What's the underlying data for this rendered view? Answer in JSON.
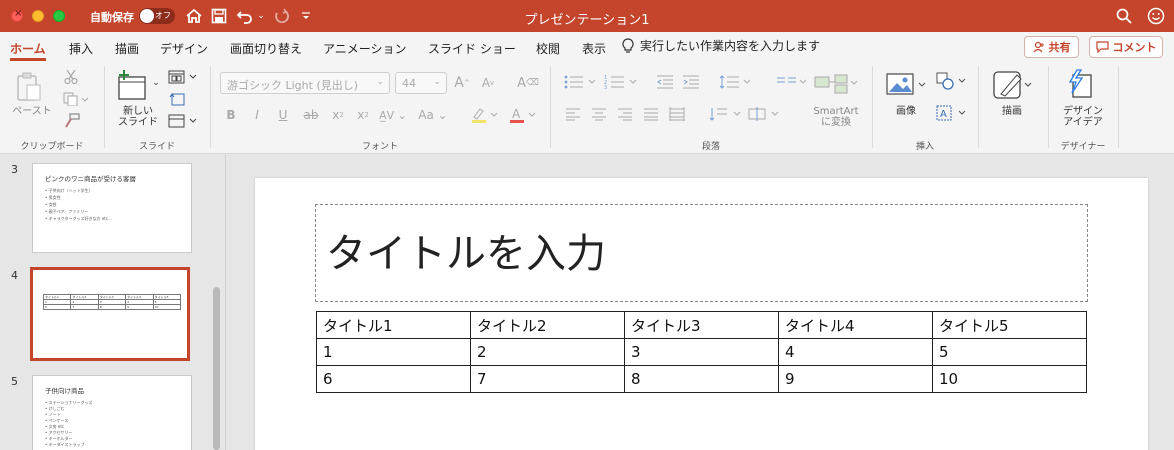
{
  "titlebar": {
    "autosave_label": "自動保存",
    "toggle_text": "オフ",
    "doc_title": "プレゼンテーション1"
  },
  "tabs": [
    {
      "label": "ホーム",
      "active": true
    },
    {
      "label": "挿入"
    },
    {
      "label": "描画"
    },
    {
      "label": "デザイン"
    },
    {
      "label": "画面切り替え"
    },
    {
      "label": "アニメーション"
    },
    {
      "label": "スライド ショー"
    },
    {
      "label": "校閲"
    },
    {
      "label": "表示"
    }
  ],
  "tellme": "実行したい作業内容を入力します",
  "share_label": "共有",
  "comment_label": "コメント",
  "ribbon": {
    "clipboard": {
      "paste": "ペースト",
      "group": "クリップボード"
    },
    "slides": {
      "new_slide_line1": "新しい",
      "new_slide_line2": "スライド",
      "group": "スライド"
    },
    "font": {
      "name": "游ゴシック Light (見出し)",
      "size": "44",
      "group": "フォント"
    },
    "paragraph": {
      "smartart_line1": "SmartArt",
      "smartart_line2": "に変換",
      "group": "段落"
    },
    "insert": {
      "image": "画像",
      "group": "挿入"
    },
    "draw": {
      "label": "描画"
    },
    "designer": {
      "line1": "デザイン",
      "line2": "アイデア",
      "group": "デザイナー"
    }
  },
  "thumbnails": [
    {
      "num": "3",
      "title": "ピンクのワニ商品が受ける客層",
      "lines": [
        "• 子供向け（ヘット学生）",
        "• 男女性",
        "• 女性",
        "• 親子ペア、ファミリー",
        "• キャラクターグッズ好きな方 etc..."
      ]
    },
    {
      "num": "4",
      "mini_table": [
        [
          "タイトル1",
          "タイトル2",
          "タイトル3",
          "タイトル4",
          "タイトル5"
        ],
        [
          "1",
          "2",
          "3",
          "4",
          "5"
        ],
        [
          "6",
          "7",
          "8",
          "9",
          "10"
        ]
      ]
    },
    {
      "num": "5",
      "title": "子供向け商品",
      "lines": [
        "• ステーショナリーグッズ",
        "   • けしごむ",
        "   • ノート",
        "   • ペンケース",
        "   • 文房 etc",
        "• アクセサリー",
        "   • キーホルダー",
        "   • キーダイストラップ"
      ]
    }
  ],
  "slide": {
    "title_placeholder": "タイトルを入力",
    "table": [
      [
        "タイトル1",
        "タイトル2",
        "タイトル3",
        "タイトル4",
        "タイトル5"
      ],
      [
        "1",
        "2",
        "3",
        "4",
        "5"
      ],
      [
        "6",
        "7",
        "8",
        "9",
        "10"
      ]
    ]
  }
}
